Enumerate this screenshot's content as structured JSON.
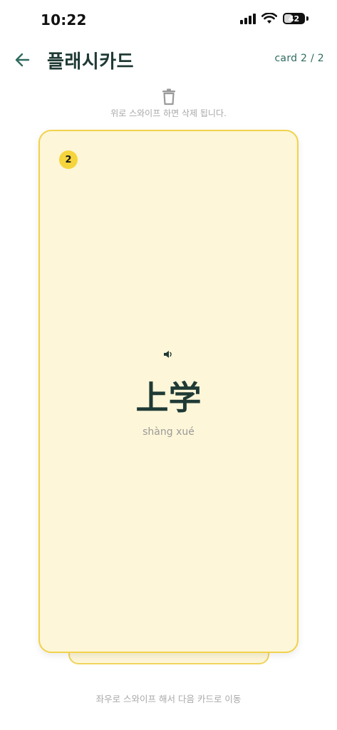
{
  "status_bar": {
    "time": "10:22",
    "battery_level": "42",
    "battery_percent": 0.42
  },
  "header": {
    "title": "플래시카드",
    "counter": "card 2 / 2"
  },
  "delete_hint": "위로 스와이프 하면 삭제 됩니다.",
  "card": {
    "index": "2",
    "hanzi": "上学",
    "pinyin": "shàng xué"
  },
  "nav_hint": "좌우로 스와이프 해서 다음 카드로 이동",
  "icons": {
    "back": "arrow-left-icon",
    "trash": "trash-icon",
    "speaker": "speaker-icon"
  },
  "colors": {
    "card_background": "#fdf6d8",
    "card_border": "#f2d24a",
    "badge": "#f6d43c",
    "title": "#1f3a35",
    "accent": "#2e6b5f"
  }
}
